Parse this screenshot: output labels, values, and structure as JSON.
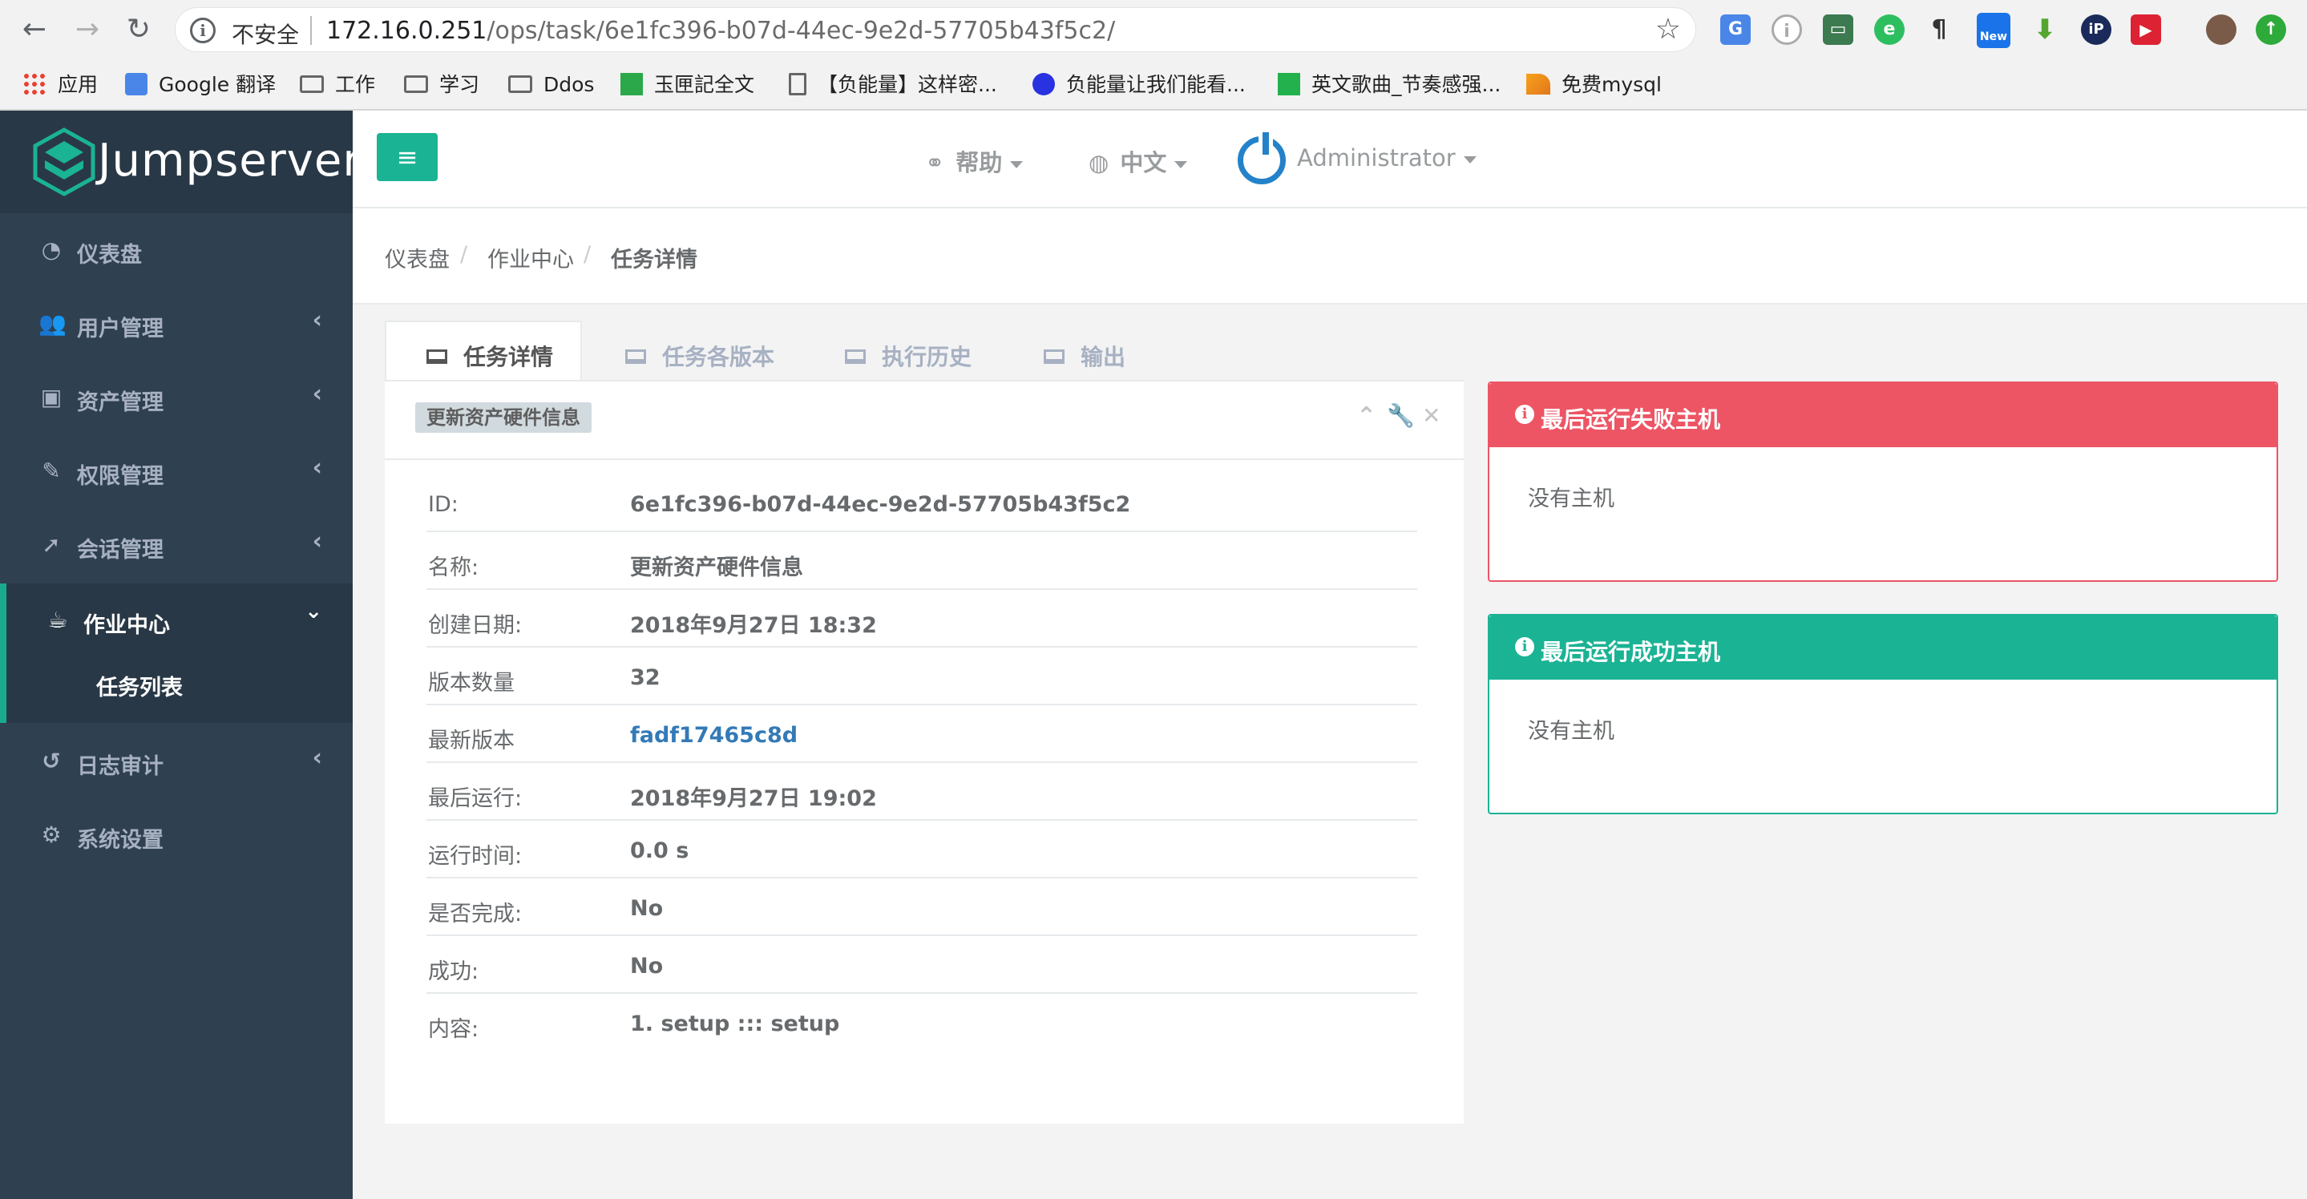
{
  "browser": {
    "insecure_label": "不安全",
    "url_host": "172.16.0.251",
    "url_path": "/ops/task/6e1fc396-b07d-44ec-9e2d-57705b43f5c2/",
    "bookmarks": [
      "应用",
      "Google 翻译",
      "工作",
      "学习",
      "Ddos",
      "玉匣記全文",
      "【负能量】这样密...",
      "负能量让我们能看...",
      "英文歌曲_节奏感强...",
      "免费mysql"
    ],
    "ext_new_badge": "New"
  },
  "logo": {
    "text": "Jumpserver"
  },
  "sidebar": {
    "items": [
      {
        "label": "仪表盘"
      },
      {
        "label": "用户管理"
      },
      {
        "label": "资产管理"
      },
      {
        "label": "权限管理"
      },
      {
        "label": "会话管理"
      },
      {
        "label": "作业中心"
      },
      {
        "label": "日志审计"
      },
      {
        "label": "系统设置"
      }
    ],
    "sub_items": [
      {
        "label": "任务列表"
      }
    ]
  },
  "header": {
    "help_label": "帮助",
    "lang_label": "中文",
    "user_label": "Administrator"
  },
  "breadcrumb": [
    "仪表盘",
    "作业中心",
    "任务详情"
  ],
  "tabs": [
    {
      "label": "任务详情"
    },
    {
      "label": "任务各版本"
    },
    {
      "label": "执行历史"
    },
    {
      "label": "输出"
    }
  ],
  "panel": {
    "badge": "更新资产硬件信息",
    "rows": [
      {
        "label": "ID:",
        "value": "6e1fc396-b07d-44ec-9e2d-57705b43f5c2"
      },
      {
        "label": "名称:",
        "value": "更新资产硬件信息"
      },
      {
        "label": "创建日期:",
        "value": "2018年9月27日 18:32"
      },
      {
        "label": "版本数量",
        "value": "32"
      },
      {
        "label": "最新版本",
        "value": "fadf17465c8d"
      },
      {
        "label": "最后运行:",
        "value": "2018年9月27日 19:02"
      },
      {
        "label": "运行时间:",
        "value": "0.0 s"
      },
      {
        "label": "是否完成:",
        "value": "No"
      },
      {
        "label": "成功:",
        "value": "No"
      },
      {
        "label": "内容:",
        "value": "1. setup ::: setup"
      }
    ]
  },
  "fail_box": {
    "title": "最后运行失败主机",
    "body": "没有主机",
    "color": "#ed5565"
  },
  "success_box": {
    "title": "最后运行成功主机",
    "body": "没有主机",
    "color": "#1ab394"
  }
}
